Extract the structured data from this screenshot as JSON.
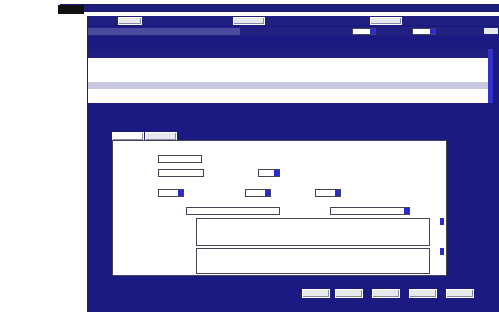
{
  "app": {
    "title_lines": [
      "",
      ""
    ]
  },
  "toolbar": {
    "left_button": "",
    "section_a": "",
    "section_b": "",
    "section_c": "",
    "section_d": "",
    "right_links": [
      "",
      "",
      "",
      ""
    ]
  },
  "table": {
    "rows": 6,
    "paging_text": ""
  },
  "sidebar": {
    "items": [
      "",
      "",
      "",
      "",
      "",
      ""
    ]
  },
  "form": {
    "group_label": "",
    "tabs": [
      "",
      ""
    ],
    "field_labels": [
      "",
      "",
      "",
      "",
      "",
      "",
      ""
    ],
    "field_values": [
      "",
      "",
      ""
    ],
    "footer_buttons": [
      "",
      "",
      "",
      "",
      ""
    ]
  },
  "colors": {
    "background": "#1a1a82",
    "header": "#202080",
    "panel": "#ffffff",
    "accent": "#2a2ad0",
    "button": "#e8e8ef"
  }
}
